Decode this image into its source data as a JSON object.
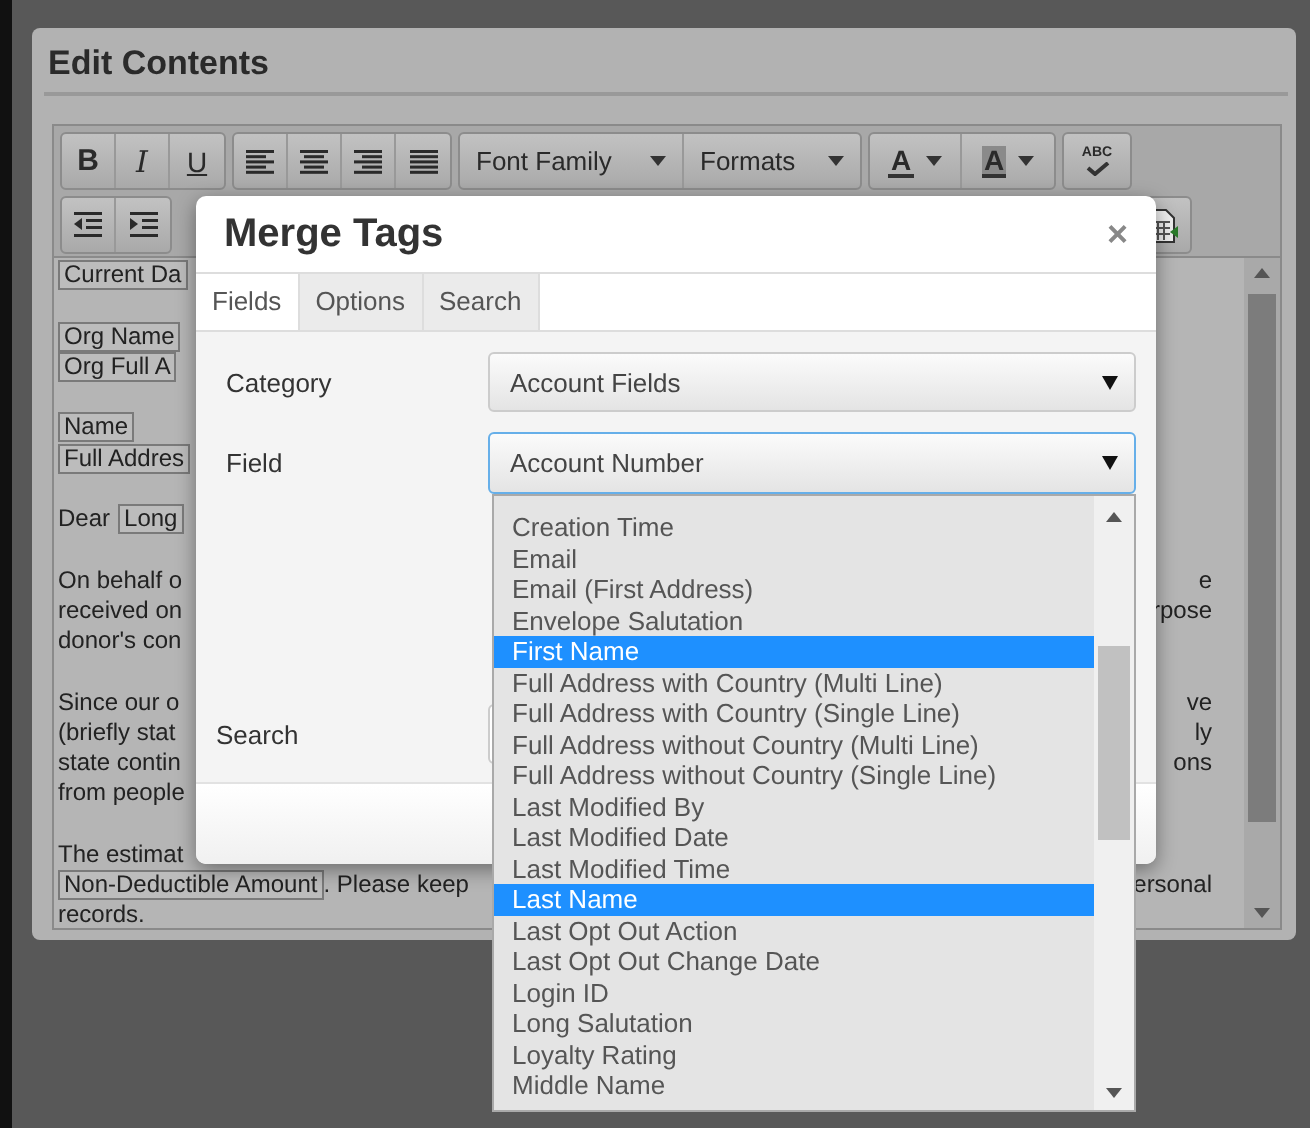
{
  "editor": {
    "title": "Edit Contents",
    "toolbar": {
      "bold": "B",
      "italic": "I",
      "underline": "U",
      "font_family": "Font Family",
      "formats": "Formats",
      "text_color": "A",
      "background_color": "A",
      "spellcheck": "ABC"
    },
    "lines": [
      {
        "kind": "text",
        "left": [
          {
            "text": "Current Da",
            "tag": true
          }
        ]
      },
      {
        "kind": "blank"
      },
      {
        "kind": "text",
        "left": [
          {
            "text": "Org Name",
            "tag": true
          }
        ]
      },
      {
        "kind": "text",
        "left": [
          {
            "text": "Org Full A",
            "tag": true
          }
        ]
      },
      {
        "kind": "blank"
      },
      {
        "kind": "text",
        "left": [
          {
            "text": "Name",
            "tag": true
          }
        ]
      },
      {
        "kind": "text",
        "left": [
          {
            "text": "Full Addres",
            "tag": true
          }
        ]
      },
      {
        "kind": "blank"
      },
      {
        "kind": "text",
        "left": [
          {
            "text": "Dear",
            "tag": false
          },
          {
            "text": "Long",
            "tag": true
          }
        ]
      },
      {
        "kind": "blank"
      },
      {
        "kind": "text",
        "left": [
          {
            "text": "On behalf o",
            "tag": false
          }
        ],
        "right": "e"
      },
      {
        "kind": "text",
        "left": [
          {
            "text": "received on",
            "tag": false
          }
        ],
        "right": "rpose"
      },
      {
        "kind": "text",
        "left": [
          {
            "text": "donor's con",
            "tag": false
          }
        ]
      },
      {
        "kind": "blank"
      },
      {
        "kind": "text",
        "left": [
          {
            "text": "Since our o",
            "tag": false
          }
        ],
        "right": "ve"
      },
      {
        "kind": "text",
        "left": [
          {
            "text": "(briefly stat",
            "tag": false
          }
        ],
        "right": "ly"
      },
      {
        "kind": "text",
        "left": [
          {
            "text": "state contin",
            "tag": false
          }
        ],
        "right": "ons"
      },
      {
        "kind": "text",
        "left": [
          {
            "text": "from people",
            "tag": false
          }
        ]
      },
      {
        "kind": "blank"
      },
      {
        "kind": "text",
        "left": [
          {
            "text": "The estimat",
            "tag": false
          }
        ]
      },
      {
        "kind": "text",
        "left": [
          {
            "text": "Non-Deductible Amount",
            "tag": true
          },
          {
            "text": ". Please keep",
            "tag": false
          }
        ],
        "right": "ersonal"
      },
      {
        "kind": "text",
        "left": [
          {
            "text": "records.",
            "tag": false
          }
        ]
      }
    ]
  },
  "dialog": {
    "title": "Merge Tags",
    "close": "×",
    "tabs": [
      {
        "label": "Fields",
        "selected": true
      },
      {
        "label": "Options",
        "selected": false
      },
      {
        "label": "Search",
        "selected": false
      }
    ],
    "category": {
      "label": "Category",
      "value": "Account Fields"
    },
    "field": {
      "label": "Field",
      "value": "Account Number",
      "focused": true
    },
    "search": {
      "label": "Search"
    }
  },
  "field_options": [
    {
      "label": "Creation Time",
      "selected": false
    },
    {
      "label": "Email",
      "selected": false
    },
    {
      "label": "Email (First Address)",
      "selected": false
    },
    {
      "label": "Envelope Salutation",
      "selected": false
    },
    {
      "label": "First Name",
      "selected": true
    },
    {
      "label": "Full Address with Country (Multi Line)",
      "selected": false
    },
    {
      "label": "Full Address with Country (Single Line)",
      "selected": false
    },
    {
      "label": "Full Address without Country (Multi Line)",
      "selected": false
    },
    {
      "label": "Full Address without Country (Single Line)",
      "selected": false
    },
    {
      "label": "Last Modified By",
      "selected": false
    },
    {
      "label": "Last Modified Date",
      "selected": false
    },
    {
      "label": "Last Modified Time",
      "selected": false
    },
    {
      "label": "Last Name",
      "selected": true
    },
    {
      "label": "Last Opt Out Action",
      "selected": false
    },
    {
      "label": "Last Opt Out Change Date",
      "selected": false
    },
    {
      "label": "Login ID",
      "selected": false
    },
    {
      "label": "Long Salutation",
      "selected": false
    },
    {
      "label": "Loyalty Rating",
      "selected": false
    },
    {
      "label": "Middle Name",
      "selected": false
    }
  ]
}
